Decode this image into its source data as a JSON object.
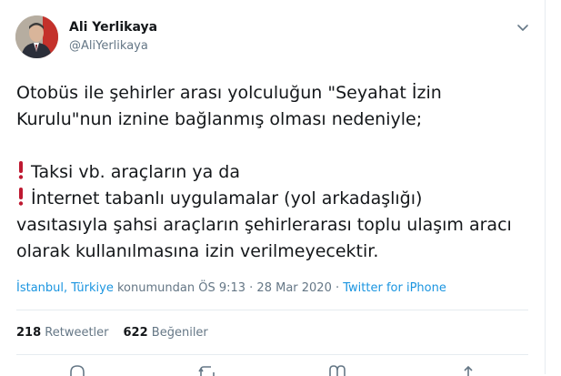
{
  "user": {
    "name": "Ali Yerlikaya",
    "handle": "@AliYerlikaya"
  },
  "tweet": {
    "line1": "Otobüs ile şehirler arası yolculuğun \"Seyahat İzin",
    "line2": "Kurulu\"nun iznine bağlanmış olması nedeniyle;",
    "line3": "Taksi vb. araçların ya da",
    "line4": "İnternet tabanlı uygulamalar (yol arkadaşlığı)",
    "line5": "vasıtasıyla şahsi araçların şehirlerarası toplu ulaşım aracı",
    "line6": "olarak kullanılmasına izin verilmeyecektir."
  },
  "meta": {
    "location": "İstanbul, Türkiye",
    "location_suffix": " konumundan",
    "time": " ÖS 9:13 · 28 Mar 2020 · ",
    "source": "Twitter for iPhone"
  },
  "stats": {
    "retweets_count": "218",
    "retweets_label": "Retweetler",
    "likes_count": "622",
    "likes_label": "Beğeniler"
  },
  "colors": {
    "text": "#14171a",
    "secondary": "#657786",
    "link": "#1b95e0",
    "exclamation": "#be1931",
    "divider": "#e6ecf0"
  },
  "icons": {
    "menu": "chevron-down-icon",
    "emoji": "red-exclamation-mark",
    "actions": [
      "reply-icon",
      "retweet-icon",
      "like-icon",
      "share-icon"
    ]
  }
}
